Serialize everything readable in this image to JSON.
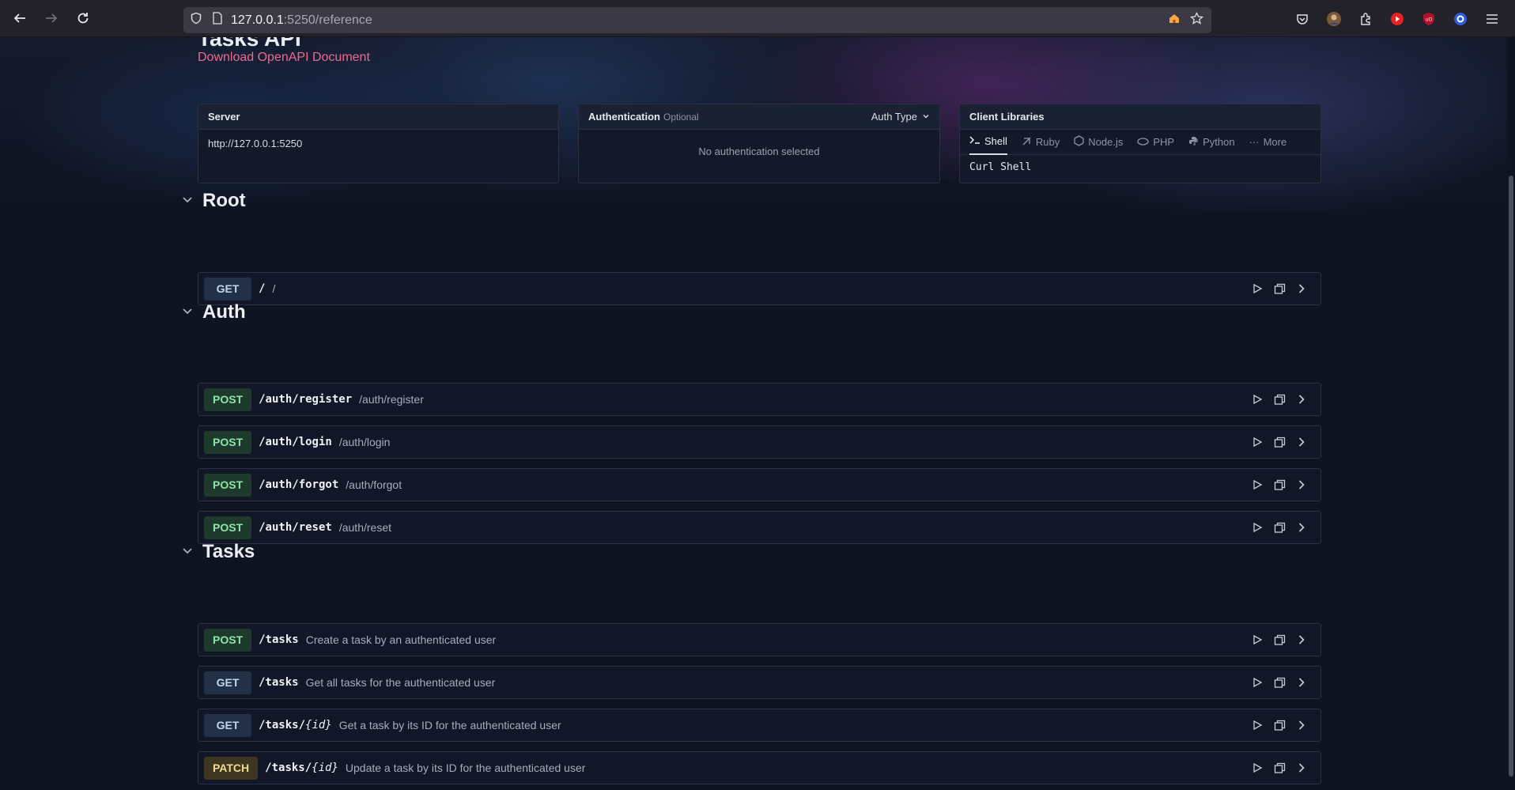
{
  "browser": {
    "url_host": "127.0.0.1",
    "url_rest": ":5250/reference",
    "back_icon": "arrow-left-icon",
    "forward_icon": "arrow-right-icon",
    "reload_icon": "reload-icon"
  },
  "header": {
    "title": "Tasks API",
    "download_link": "Download OpenAPI Document"
  },
  "server": {
    "label": "Server",
    "url": "http://127.0.0.1:5250"
  },
  "authentication": {
    "label": "Authentication",
    "optional": "Optional",
    "auth_type": "Auth Type",
    "empty": "No authentication selected"
  },
  "client_libraries": {
    "label": "Client Libraries",
    "tabs": [
      "Shell",
      "Ruby",
      "Node.js",
      "PHP",
      "Python",
      "More"
    ],
    "active": "Curl Shell"
  },
  "sections": [
    {
      "title": "Root",
      "rows": [
        {
          "method": "GET",
          "path": "/",
          "summary": "/"
        }
      ]
    },
    {
      "title": "Auth",
      "rows": [
        {
          "method": "POST",
          "path": "/auth/register",
          "summary": "/auth/register"
        },
        {
          "method": "POST",
          "path": "/auth/login",
          "summary": "/auth/login"
        },
        {
          "method": "POST",
          "path": "/auth/forgot",
          "summary": "/auth/forgot"
        },
        {
          "method": "POST",
          "path": "/auth/reset",
          "summary": "/auth/reset"
        }
      ]
    },
    {
      "title": "Tasks",
      "rows": [
        {
          "method": "POST",
          "path": "/tasks",
          "summary": "Create a task by an authenticated user"
        },
        {
          "method": "GET",
          "path": "/tasks",
          "summary": "Get all tasks for the authenticated user"
        },
        {
          "method": "GET",
          "path_prefix": "/tasks/",
          "path_param": "{id}",
          "summary": "Get a task by its ID for the authenticated user"
        },
        {
          "method": "PATCH",
          "path_prefix": "/tasks/",
          "path_param": "{id}",
          "summary": "Update a task by its ID for the authenticated user"
        }
      ]
    }
  ]
}
